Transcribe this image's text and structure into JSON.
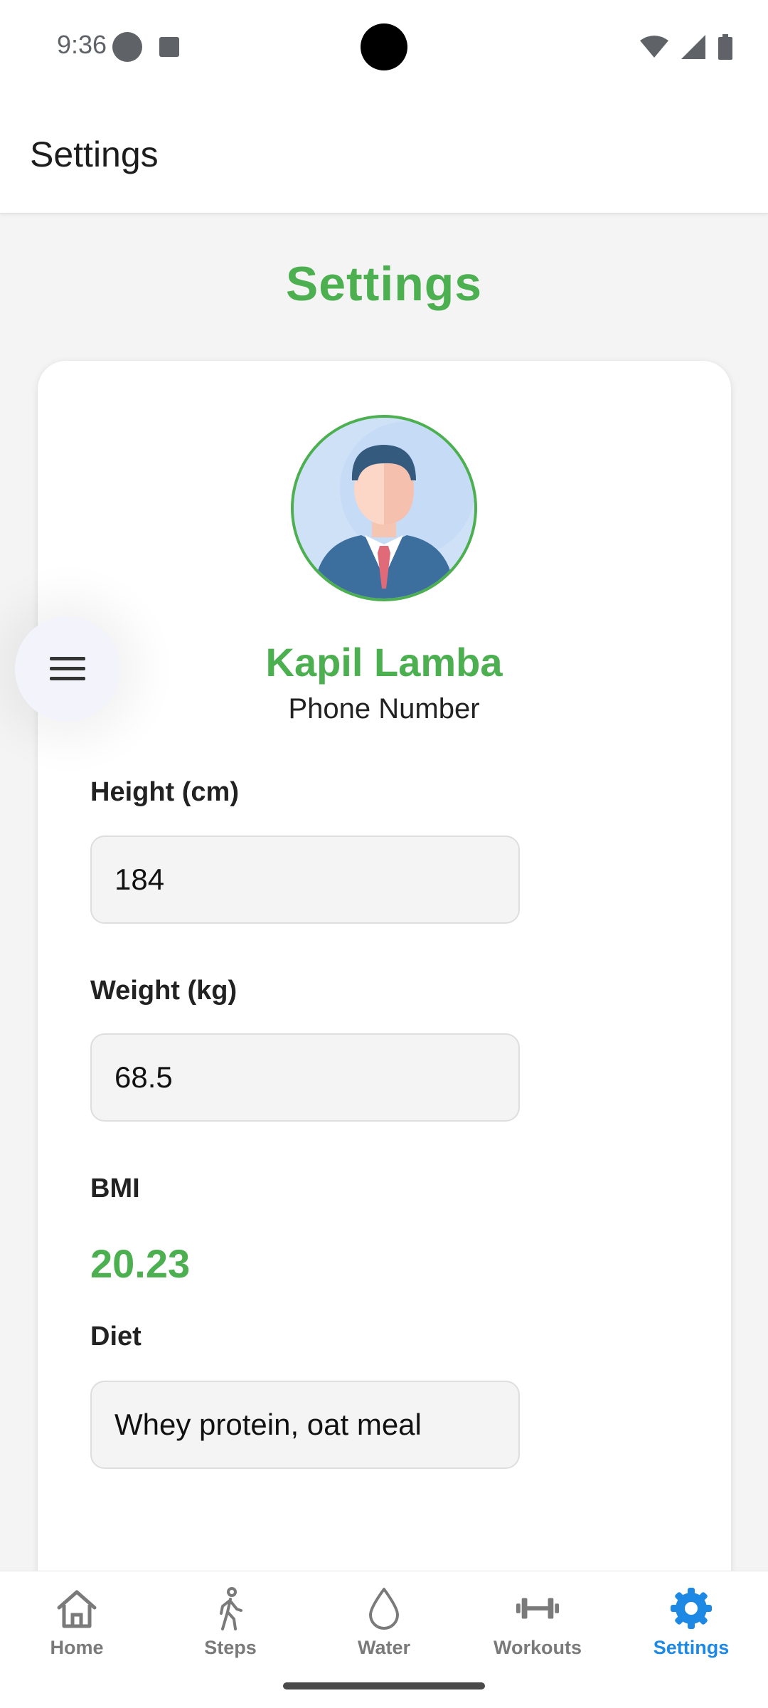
{
  "status_bar": {
    "time": "9:36"
  },
  "app_bar": {
    "title": "Settings"
  },
  "page": {
    "title": "Settings"
  },
  "profile": {
    "name": "Kapil Lamba",
    "subtitle": "Phone Number"
  },
  "fields": {
    "height": {
      "label": "Height (cm)",
      "value": "184"
    },
    "weight": {
      "label": "Weight (kg)",
      "value": "68.5"
    },
    "bmi": {
      "label": "BMI",
      "value": "20.23"
    },
    "diet": {
      "label": "Diet",
      "value": "Whey protein, oat meal"
    }
  },
  "bottom_nav": {
    "items": [
      {
        "label": "Home",
        "icon": "home-icon"
      },
      {
        "label": "Steps",
        "icon": "walking-icon"
      },
      {
        "label": "Water",
        "icon": "water-drop-icon"
      },
      {
        "label": "Workouts",
        "icon": "dumbbell-icon"
      },
      {
        "label": "Settings",
        "icon": "gear-icon"
      }
    ],
    "active_index": 4
  },
  "colors": {
    "accent_green": "#4caf50",
    "active_blue": "#1e88e5",
    "inactive_gray": "#7a7a7a"
  }
}
